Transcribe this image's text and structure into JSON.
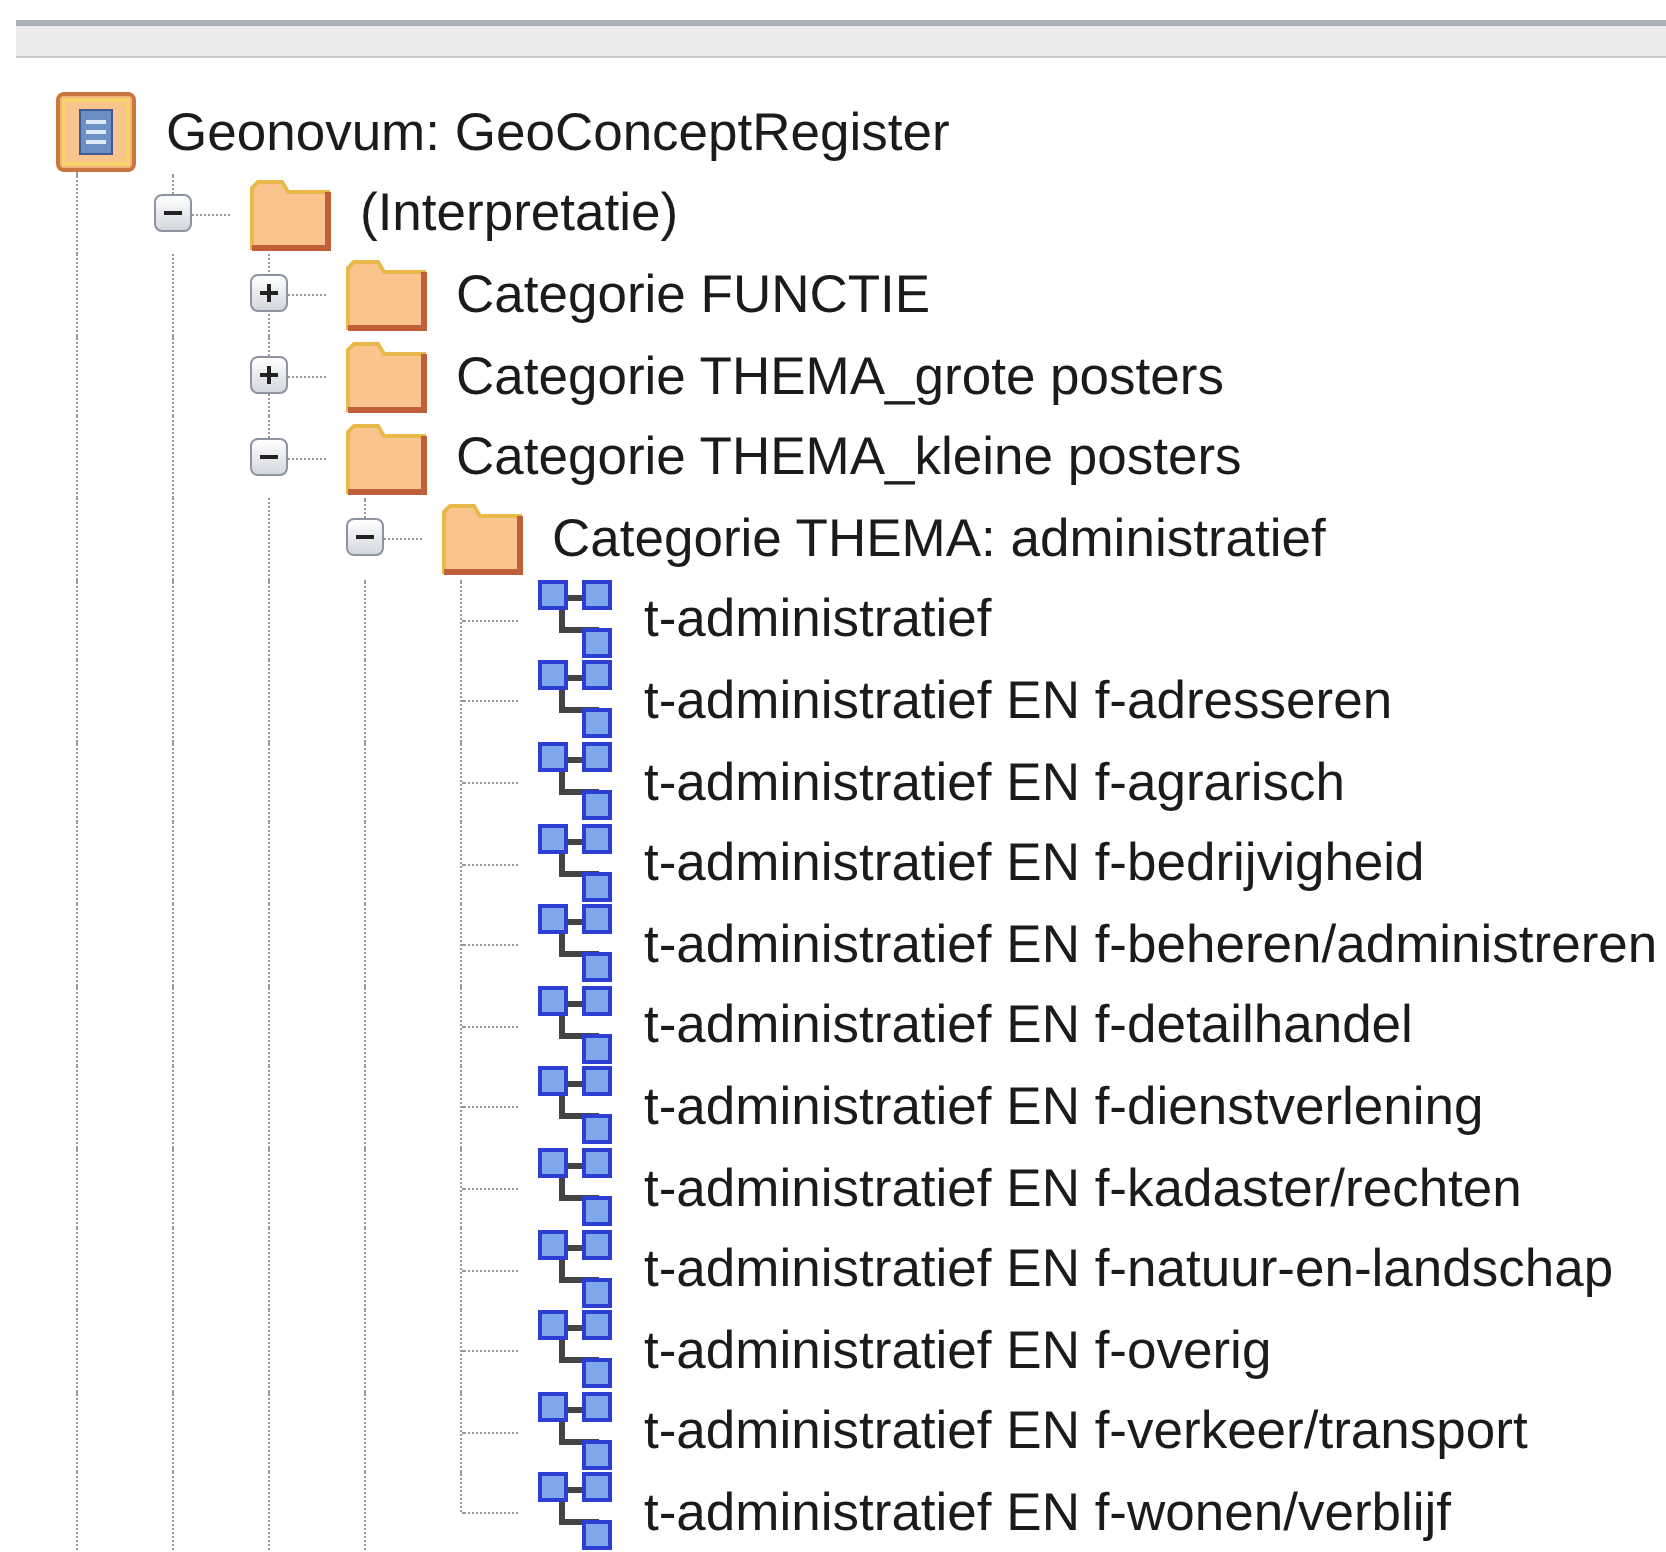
{
  "tree": {
    "label": "Geonovum: GeoConceptRegister",
    "kind": "register",
    "children": [
      {
        "label": "(Interpretatie)",
        "kind": "folder",
        "expanded": true,
        "children": [
          {
            "label": "Categorie FUNCTIE",
            "kind": "folder",
            "expanded": false
          },
          {
            "label": "Categorie THEMA_grote posters",
            "kind": "folder",
            "expanded": false
          },
          {
            "label": "Categorie THEMA_kleine posters",
            "kind": "folder",
            "expanded": true,
            "children": [
              {
                "label": "Categorie THEMA: administratief",
                "kind": "folder",
                "expanded": true,
                "children": [
                  {
                    "label": "t-administratief",
                    "kind": "diagram"
                  },
                  {
                    "label": "t-administratief EN f-adresseren",
                    "kind": "diagram"
                  },
                  {
                    "label": "t-administratief EN f-agrarisch",
                    "kind": "diagram"
                  },
                  {
                    "label": "t-administratief EN f-bedrijvigheid",
                    "kind": "diagram"
                  },
                  {
                    "label": "t-administratief EN f-beheren/administreren",
                    "kind": "diagram"
                  },
                  {
                    "label": "t-administratief EN f-detailhandel",
                    "kind": "diagram"
                  },
                  {
                    "label": "t-administratief EN f-dienstverlening",
                    "kind": "diagram"
                  },
                  {
                    "label": "t-administratief EN f-kadaster/rechten",
                    "kind": "diagram"
                  },
                  {
                    "label": "t-administratief EN f-natuur-en-landschap",
                    "kind": "diagram"
                  },
                  {
                    "label": "t-administratief EN f-overig",
                    "kind": "diagram"
                  },
                  {
                    "label": "t-administratief EN f-verkeer/transport",
                    "kind": "diagram"
                  },
                  {
                    "label": "t-administratief EN f-wonen/verblijf",
                    "kind": "diagram"
                  }
                ]
              }
            ]
          }
        ]
      }
    ]
  }
}
